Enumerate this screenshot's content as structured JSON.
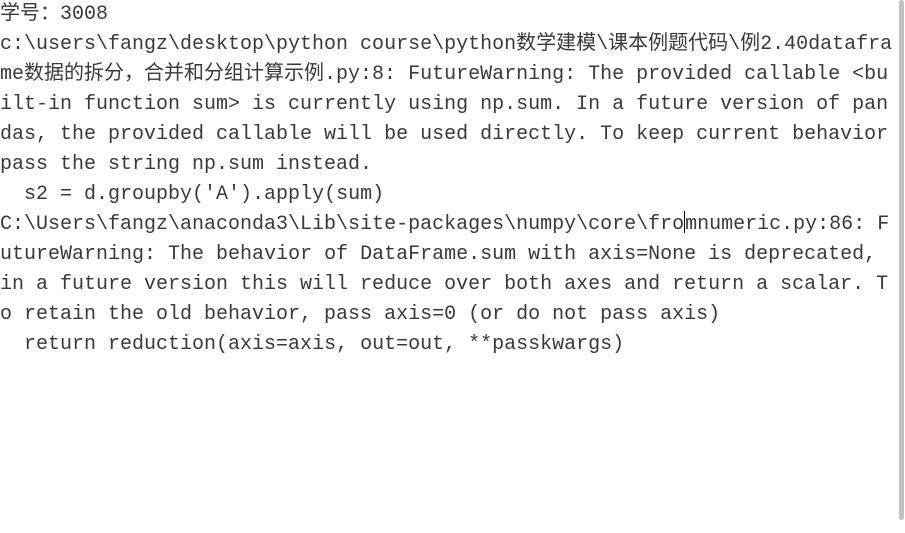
{
  "output": {
    "header_line": "学号：3008",
    "warning1": {
      "path": "c:\\users\\fangz\\desktop\\python course\\python数学建模\\课本例题代码\\例2.40dataframe数据的拆分，合并和分组计算示例.py",
      "line_no": "8",
      "category": "FutureWarning",
      "message": "The provided callable <built-in function sum> is currently using np.sum. In a future version of pandas, the provided callable will be used directly. To keep current behavior pass the string np.sum instead.",
      "code": "  s2 = d.groupby('A').apply(sum)"
    },
    "warning2": {
      "path_part1": "C:\\Users\\fangz\\anaconda3\\Lib\\site-packages\\numpy\\core\\fro",
      "path_part2": "mnumeric.py",
      "line_no": "86",
      "category": "FutureWarning",
      "message": "The behavior of DataFrame.sum with axis=None is deprecated, in a future version this will reduce over both axes and return a scalar. To retain the old behavior, pass axis=0 (or do not pass axis)",
      "code": "  return reduction(axis=axis, out=out, **passkwargs)"
    }
  }
}
